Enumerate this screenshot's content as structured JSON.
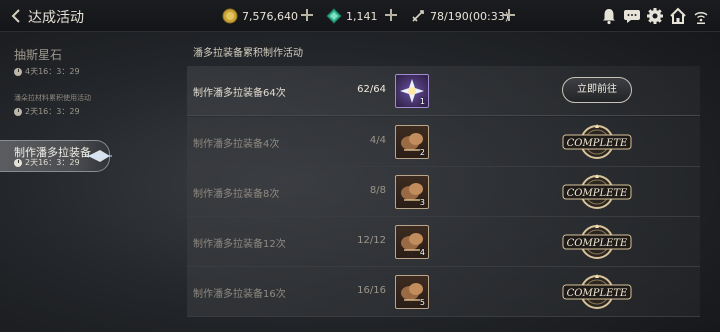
{
  "header": {
    "title": "达成活动",
    "gold": "7,576,640",
    "gems": "1,141",
    "stamina": "78/190(00:33)"
  },
  "sidebar": {
    "items": [
      {
        "title": "抽斯星石",
        "time": "4天16：3：29"
      },
      {
        "title": "潘朵拉材料累积使用活动",
        "time": "2天16：3：29"
      },
      {
        "title": "制作潘多拉装备",
        "time": "2天16：3：29"
      }
    ]
  },
  "main": {
    "section_title": "潘多拉装备累积制作活动",
    "rows": [
      {
        "label": "制作潘多拉装备64次",
        "count": "62/64",
        "item_qty": "1",
        "action": "立即前往"
      },
      {
        "label": "制作潘多拉装备4次",
        "count": "4/4",
        "item_qty": "2",
        "action": "COMPLETE"
      },
      {
        "label": "制作潘多拉装备8次",
        "count": "8/8",
        "item_qty": "3",
        "action": "COMPLETE"
      },
      {
        "label": "制作潘多拉装备12次",
        "count": "12/12",
        "item_qty": "4",
        "action": "COMPLETE"
      },
      {
        "label": "制作潘多拉装备16次",
        "count": "16/16",
        "item_qty": "5",
        "action": "COMPLETE"
      }
    ]
  },
  "icons": [
    "back-icon",
    "gold-coin-icon",
    "gem-icon",
    "stamina-icon",
    "bell-icon",
    "chat-icon",
    "gear-icon",
    "home-icon",
    "wifi-icon"
  ]
}
